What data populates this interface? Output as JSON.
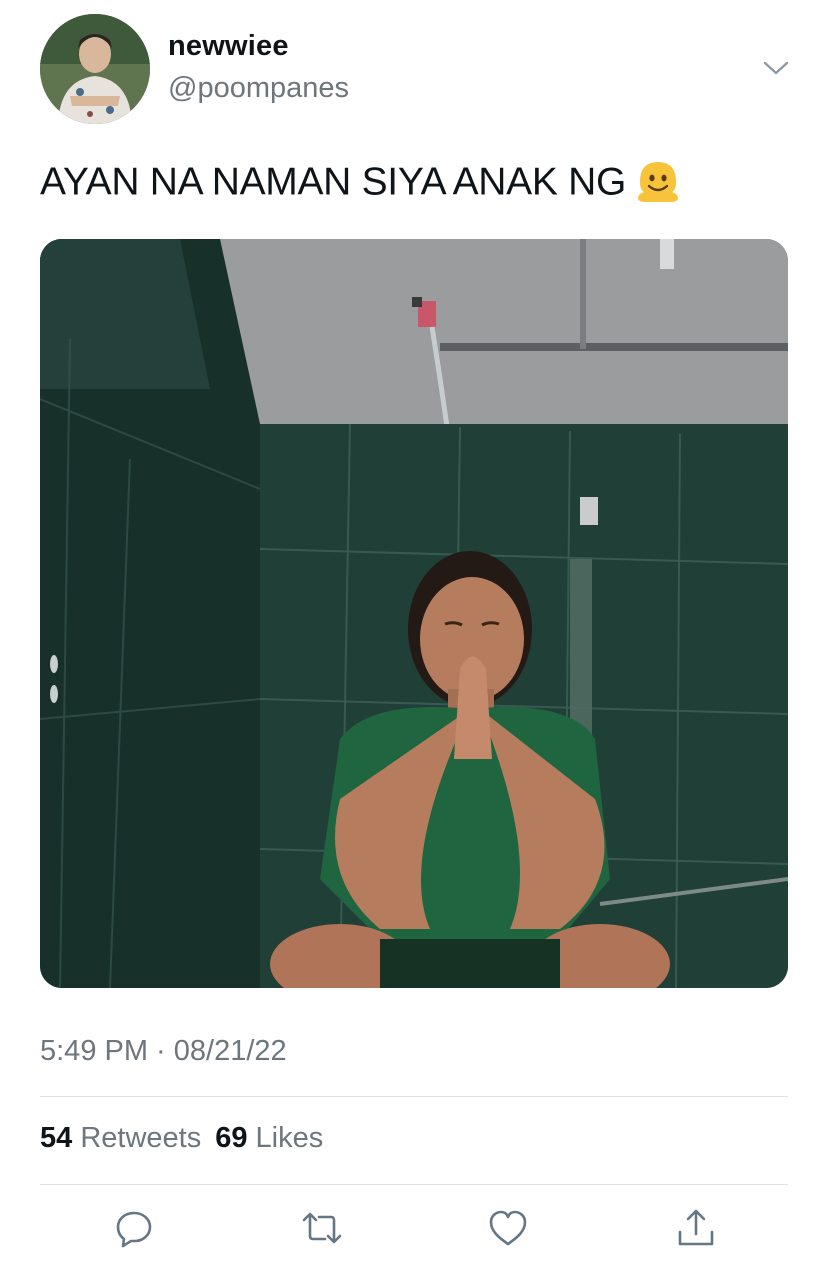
{
  "author": {
    "display_name": "newwiee",
    "handle": "@poompanes",
    "avatar_icon": "profile-photo"
  },
  "tweet": {
    "text": "AYAN NA NAMAN SIYA ANAK NG",
    "emoji_icon": "melting-face-emoji",
    "media_icon": "photo-shower-scene",
    "timestamp": "5:49 PM · 08/21/22"
  },
  "stats": {
    "retweets_count": "54",
    "retweets_label": "Retweets",
    "likes_count": "69",
    "likes_label": "Likes"
  },
  "actions": {
    "reply_icon": "reply-icon",
    "retweet_icon": "retweet-icon",
    "like_icon": "heart-icon",
    "share_icon": "share-icon"
  },
  "colors": {
    "text_primary": "#0f1419",
    "text_secondary": "#6e767d",
    "divider": "#dfe3e6",
    "icon": "#657786"
  }
}
